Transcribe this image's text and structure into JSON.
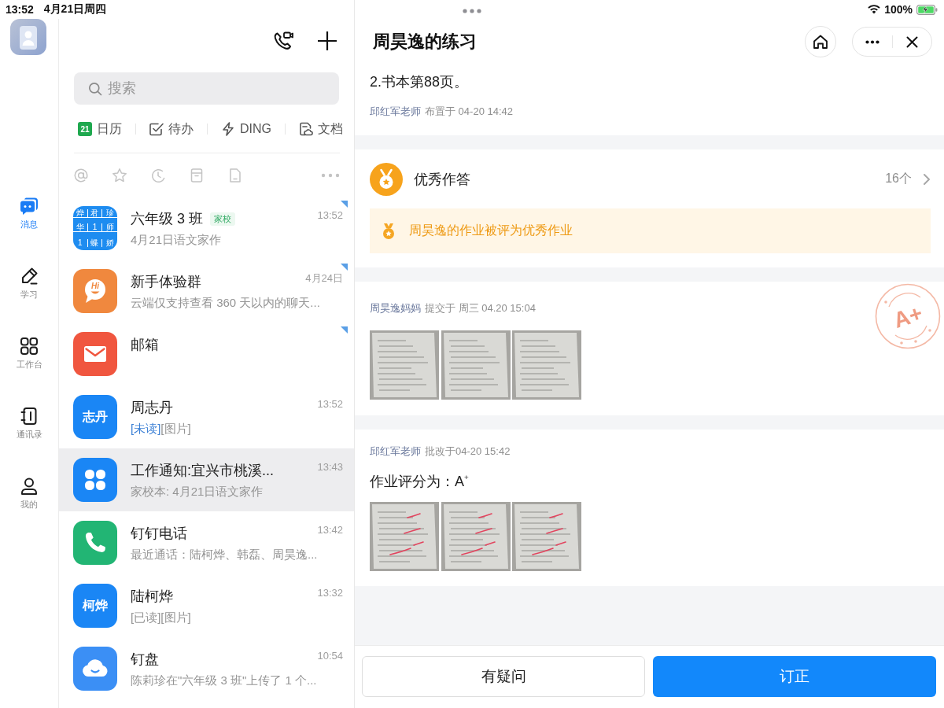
{
  "status_bar": {
    "time": "13:52",
    "date": "4月21日周四",
    "battery": "100%",
    "charging": true
  },
  "nav": {
    "items": [
      {
        "kind": "chat",
        "label": "消息",
        "selected": true
      },
      {
        "kind": "pencil",
        "label": "学习",
        "selected": false
      },
      {
        "kind": "apps",
        "label": "工作台",
        "selected": false
      },
      {
        "kind": "contacts",
        "label": "通讯录",
        "selected": false
      },
      {
        "kind": "profile",
        "label": "我的",
        "selected": false
      }
    ]
  },
  "chat_panel": {
    "search": {
      "placeholder": "搜索"
    },
    "shortcuts": [
      {
        "kind": "calendar",
        "label": "日历",
        "day": "21"
      },
      {
        "kind": "todo",
        "label": "待办"
      },
      {
        "kind": "ding",
        "label": "DING"
      },
      {
        "kind": "docs",
        "label": "文档"
      }
    ],
    "conversations": [
      {
        "title": "六年级 3 班",
        "tag": "家校",
        "time": "13:52",
        "preview": "4月21日语文家作",
        "pinned": true,
        "selected": false,
        "avatar": {
          "kind": "grid",
          "color": "#1e8cf0",
          "cells": [
            "烨",
            "君",
            "珍",
            "华",
            "1",
            "师",
            "1",
            "蝶",
            "娇"
          ]
        }
      },
      {
        "title": "新手体验群",
        "time": "4月24日",
        "preview": "云端仅支持查看 360 天以内的聊天...",
        "pinned": true,
        "selected": false,
        "avatar": {
          "kind": "hi",
          "color": "#f0883e",
          "text": "Hi"
        }
      },
      {
        "title": "邮箱",
        "pinned": true,
        "selected": false,
        "avatar": {
          "kind": "mail",
          "color": "#f0563f"
        }
      },
      {
        "title": "周志丹",
        "time": "13:52",
        "status": {
          "text": "[未读]",
          "unread": true
        },
        "preview": "[图片]",
        "pinned": false,
        "selected": false,
        "avatar": {
          "kind": "initials",
          "color": "#1a86f5",
          "text": "志丹"
        }
      },
      {
        "title": "工作通知:宜兴市桃溪...",
        "time": "13:43",
        "preview": "家校本: 4月21日语文家作",
        "pinned": false,
        "selected": true,
        "avatar": {
          "kind": "clover",
          "color": "#1a86f5"
        }
      },
      {
        "title": "钉钉电话",
        "time": "13:42",
        "preview": "最近通话：陆柯烨、韩磊、周昊逸...",
        "pinned": false,
        "selected": false,
        "avatar": {
          "kind": "phone",
          "color": "#22b574"
        }
      },
      {
        "title": "陆柯烨",
        "time": "13:32",
        "status": {
          "text": "[已读]",
          "unread": false
        },
        "preview": "[图片]",
        "pinned": false,
        "selected": false,
        "avatar": {
          "kind": "initials",
          "color": "#1a86f5",
          "text": "柯烨"
        }
      },
      {
        "title": "钉盘",
        "time": "10:54",
        "preview": "陈莉珍在\"六年级 3 班\"上传了 1 个...",
        "pinned": false,
        "selected": false,
        "avatar": {
          "kind": "cloud",
          "color": "#3b8ff5"
        }
      }
    ]
  },
  "detail": {
    "title": "周昊逸的练习",
    "assignment": {
      "lines": [
        "2.书本第88页。"
      ],
      "teacher": "邱红军老师",
      "meta": "布置于 04-20 14:42"
    },
    "excellent": {
      "title": "优秀作答",
      "count": "16个",
      "notice": "周昊逸的作业被评为优秀作业"
    },
    "submission": {
      "author": "周昊逸妈妈",
      "meta": "提交于 周三 04.20 15:04",
      "stamp": "A+",
      "photos": [
        {
          "marked": false
        },
        {
          "marked": false
        },
        {
          "marked": false
        }
      ]
    },
    "review": {
      "teacher": "邱红军老师",
      "meta": "批改于04-20 15:42",
      "grade": "作业评分为：A$^{+}$",
      "photos": [
        {
          "marked": true
        },
        {
          "marked": true
        },
        {
          "marked": true
        }
      ]
    },
    "actions": [
      {
        "label": "有疑问",
        "primary": false
      },
      {
        "label": "订正",
        "primary": true
      }
    ]
  }
}
